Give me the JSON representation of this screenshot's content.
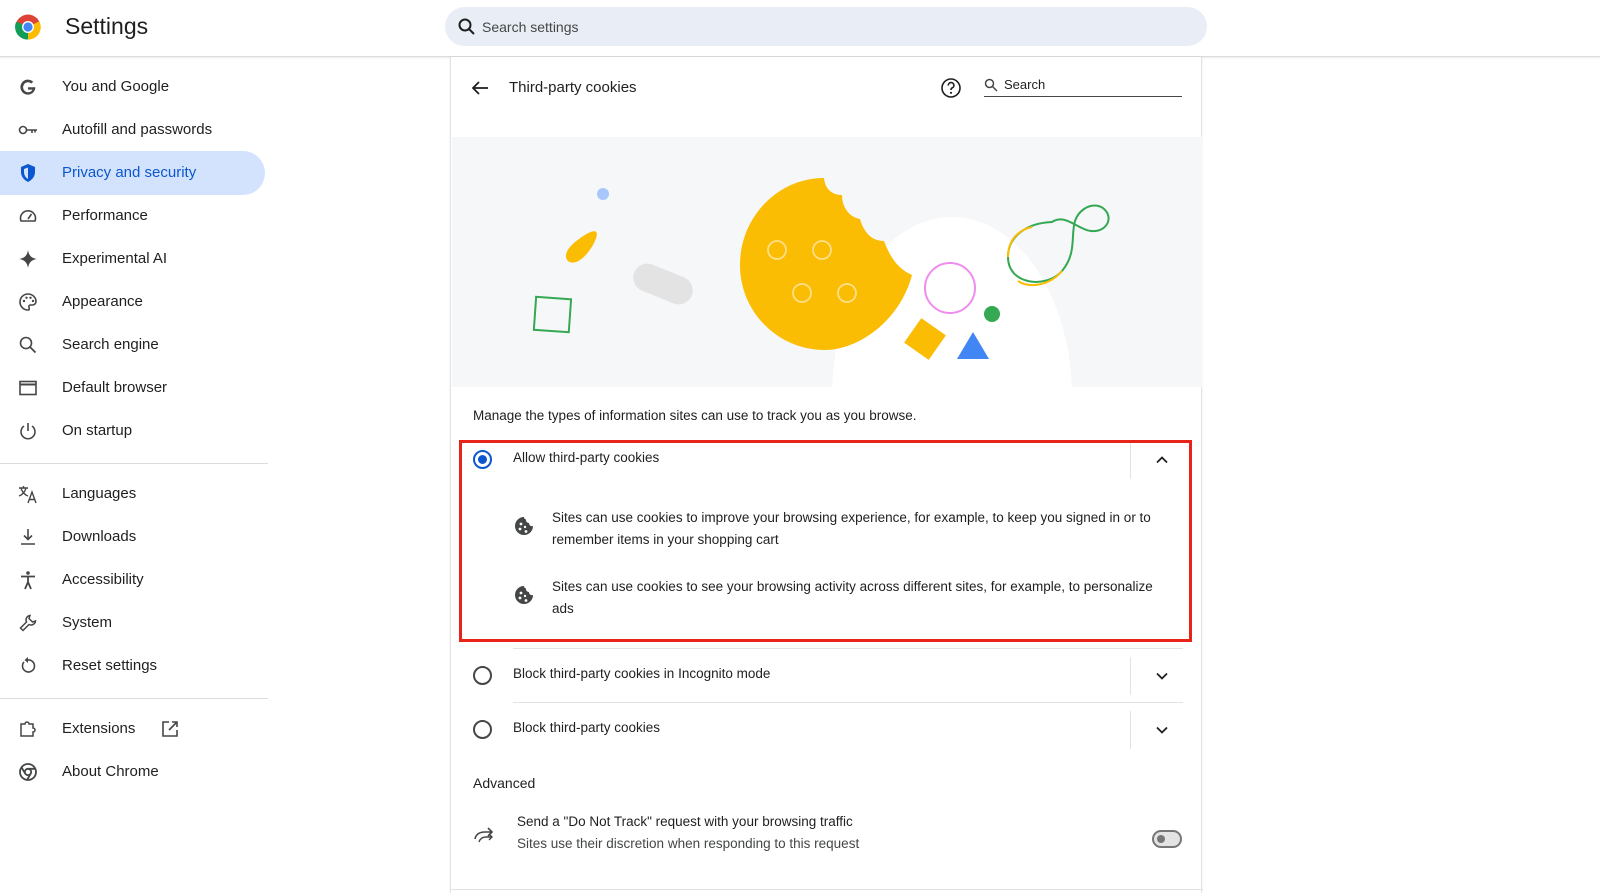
{
  "app": {
    "title": "Settings"
  },
  "search": {
    "placeholder": "Search settings"
  },
  "sidebar": {
    "items": [
      {
        "label": "You and Google",
        "icon": "google-g-icon"
      },
      {
        "label": "Autofill and passwords",
        "icon": "key-icon"
      },
      {
        "label": "Privacy and security",
        "icon": "shield-icon",
        "active": true
      },
      {
        "label": "Performance",
        "icon": "speedometer-icon"
      },
      {
        "label": "Experimental AI",
        "icon": "sparkle-icon"
      },
      {
        "label": "Appearance",
        "icon": "palette-icon"
      },
      {
        "label": "Search engine",
        "icon": "search-icon"
      },
      {
        "label": "Default browser",
        "icon": "browser-window-icon"
      },
      {
        "label": "On startup",
        "icon": "power-icon"
      },
      {
        "label": "Languages",
        "icon": "translate-icon"
      },
      {
        "label": "Downloads",
        "icon": "download-icon"
      },
      {
        "label": "Accessibility",
        "icon": "accessibility-icon"
      },
      {
        "label": "System",
        "icon": "wrench-icon"
      },
      {
        "label": "Reset settings",
        "icon": "reset-icon"
      },
      {
        "label": "Extensions",
        "icon": "puzzle-icon"
      },
      {
        "label": "About Chrome",
        "icon": "chrome-icon"
      }
    ]
  },
  "page": {
    "title": "Third-party cookies",
    "search_placeholder": "Search",
    "description": "Manage the types of information sites can use to track you as you browse."
  },
  "options": [
    {
      "label": "Allow third-party cookies",
      "selected": true,
      "expanded": true,
      "details": [
        "Sites can use cookies to improve your browsing experience, for example, to keep you signed in or to remember items in your shopping cart",
        "Sites can use cookies to see your browsing activity across different sites, for example, to personalize ads"
      ]
    },
    {
      "label": "Block third-party cookies in Incognito mode",
      "selected": false,
      "expanded": false
    },
    {
      "label": "Block third-party cookies",
      "selected": false,
      "expanded": false
    }
  ],
  "advanced": {
    "label": "Advanced",
    "dnt_title": "Send a \"Do Not Track\" request with your browsing traffic",
    "dnt_subtitle": "Sites use their discretion when responding to this request",
    "dnt_enabled": false
  },
  "colors": {
    "accent": "#0b57d0",
    "active_bg": "#d3e3fd",
    "highlight": "#e8231a",
    "cookie": "#fbbc04"
  }
}
